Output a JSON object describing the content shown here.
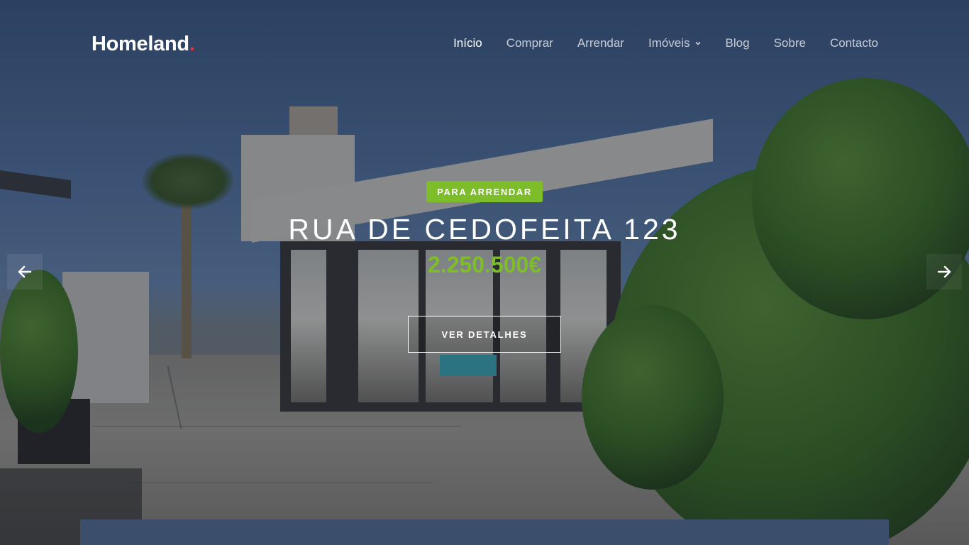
{
  "header": {
    "logo_text": "Homeland",
    "logo_dot": ".",
    "nav": [
      {
        "label": "Início",
        "active": true
      },
      {
        "label": "Comprar",
        "active": false
      },
      {
        "label": "Arrendar",
        "active": false
      },
      {
        "label": "Imóveis",
        "active": false,
        "icon": "chevron-down-icon"
      },
      {
        "label": "Blog",
        "active": false
      },
      {
        "label": "Sobre",
        "active": false
      },
      {
        "label": "Contacto",
        "active": false
      }
    ]
  },
  "slide": {
    "badge": "PARA ARRENDAR",
    "title": "RUA DE CEDOFEITA 123",
    "price": "2.250.500€",
    "cta_label": "VER DETALHES",
    "prev_icon": "arrow-left-icon",
    "next_icon": "arrow-right-icon"
  },
  "colors": {
    "accent_green": "#7ebd2a",
    "logo_dot_red": "#e0323c",
    "search_panel": "#3b4e6b"
  }
}
